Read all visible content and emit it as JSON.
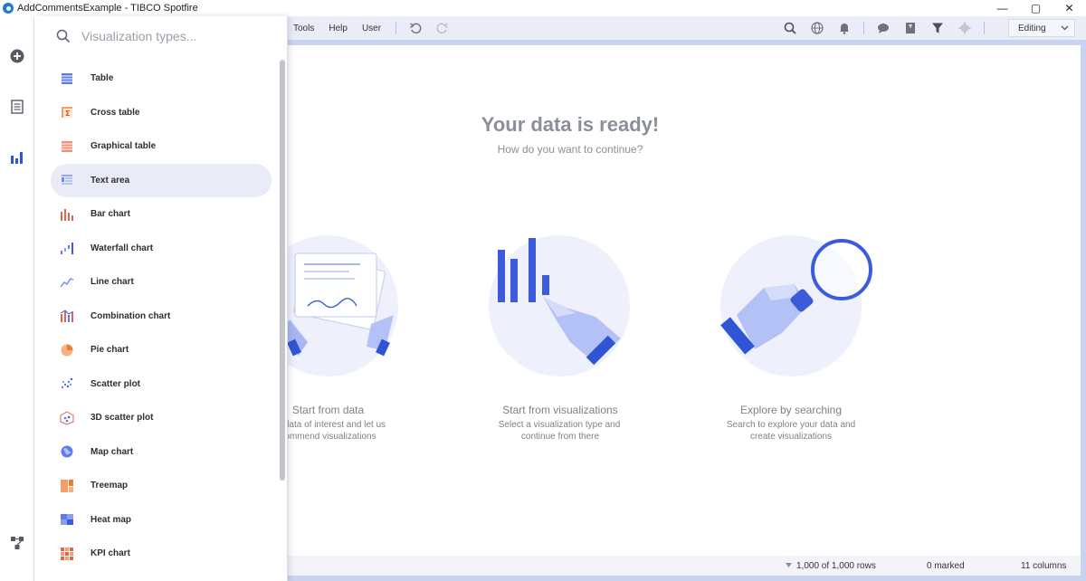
{
  "window": {
    "title": "AddCommentsExample - TIBCO Spotfire",
    "minimize": "—",
    "maximize": "▢",
    "close": "✕"
  },
  "rail": {
    "add_icon": "plus-circle-icon",
    "data_icon": "data-panel-icon",
    "visualizations_icon": "bar-chart-icon",
    "bottom_icon": "data-flow-icon"
  },
  "menu": {
    "tools": "Tools",
    "help": "Help",
    "user": "User"
  },
  "mode": {
    "value": "Editing"
  },
  "search": {
    "placeholder": "Visualization types..."
  },
  "visualization_types": [
    {
      "label": "Table",
      "icon": "table-icon"
    },
    {
      "label": "Cross table",
      "icon": "cross-table-icon"
    },
    {
      "label": "Graphical table",
      "icon": "graphical-table-icon"
    },
    {
      "label": "Text area",
      "icon": "text-area-icon",
      "selected": true
    },
    {
      "label": "Bar chart",
      "icon": "bar-chart-icon"
    },
    {
      "label": "Waterfall chart",
      "icon": "waterfall-chart-icon"
    },
    {
      "label": "Line chart",
      "icon": "line-chart-icon"
    },
    {
      "label": "Combination chart",
      "icon": "combination-chart-icon"
    },
    {
      "label": "Pie chart",
      "icon": "pie-chart-icon"
    },
    {
      "label": "Scatter plot",
      "icon": "scatter-plot-icon"
    },
    {
      "label": "3D scatter plot",
      "icon": "3d-scatter-plot-icon"
    },
    {
      "label": "Map chart",
      "icon": "map-chart-icon"
    },
    {
      "label": "Treemap",
      "icon": "treemap-icon"
    },
    {
      "label": "Heat map",
      "icon": "heat-map-icon"
    },
    {
      "label": "KPI chart",
      "icon": "kpi-chart-icon"
    }
  ],
  "welcome": {
    "title": "Your data is ready!",
    "subtitle": "How do you want to continue?",
    "cards": [
      {
        "title": "Start from data",
        "line1": "data of interest and let us",
        "line2": "ommend visualizations"
      },
      {
        "title": "Start from visualizations",
        "line1": "Select a visualization type and",
        "line2": "continue from there"
      },
      {
        "title": "Explore by searching",
        "line1": "Search to explore your data and",
        "line2": "create visualizations"
      }
    ]
  },
  "status": {
    "rows": "1,000 of 1,000 rows",
    "marked": "0 marked",
    "columns": "11 columns"
  },
  "colors": {
    "accent": "#3b5bdb",
    "illustration_bg": "#eef1fc",
    "workspace_bg": "#c9d3ef"
  }
}
